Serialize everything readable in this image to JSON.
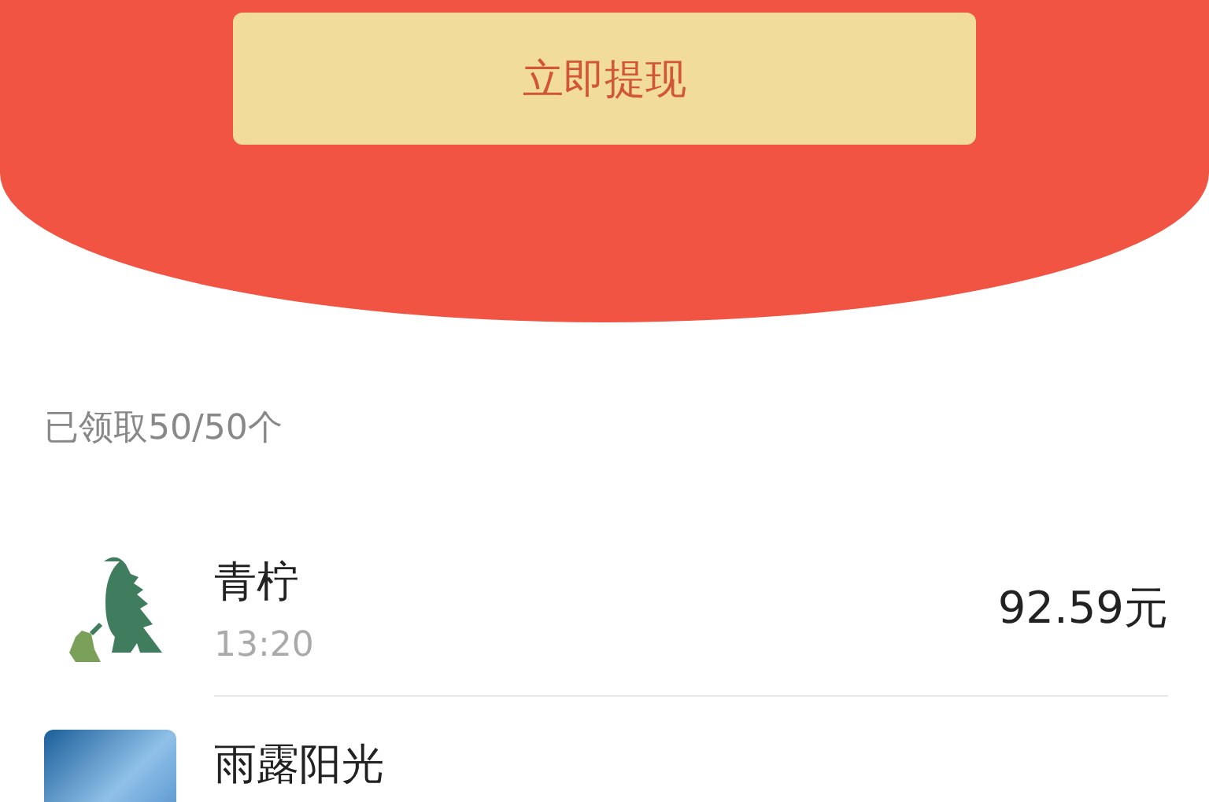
{
  "header": {
    "button": "立即提现"
  },
  "summary": "已领取50/50个",
  "records": [
    {
      "kind": "cartoon",
      "name": "青柠",
      "time": "13:20",
      "amount": "92.59元"
    },
    {
      "kind": "photo",
      "name": "雨露阳光"
    }
  ]
}
